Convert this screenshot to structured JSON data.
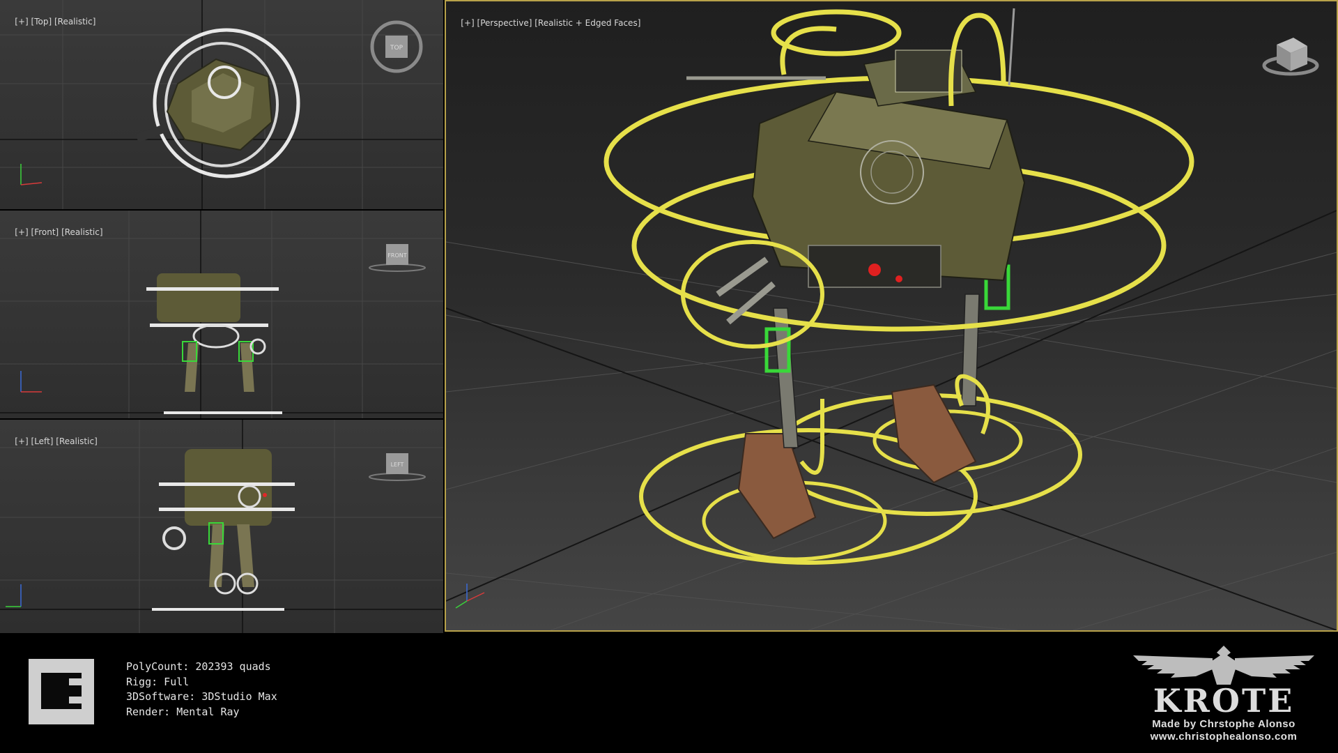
{
  "viewports": {
    "top": {
      "label_plus": "[+]",
      "label_view": "[Top]",
      "label_mode": "[Realistic]",
      "cube_label": "TOP"
    },
    "front": {
      "label_plus": "[+]",
      "label_view": "[Front]",
      "label_mode": "[Realistic]",
      "cube_label": "FRONT"
    },
    "left": {
      "label_plus": "[+]",
      "label_view": "[Left]",
      "label_mode": "[Realistic]",
      "cube_label": "LEFT"
    },
    "perspective": {
      "label_plus": "[+]",
      "label_view": "[Perspective]",
      "label_mode": "[Realistic + Edged Faces]"
    }
  },
  "stats": {
    "polycount": "PolyCount: 202393 quads",
    "rig": "Rigg: Full",
    "software": "3DSoftware: 3DStudio Max",
    "render": "Render: Mental Ray"
  },
  "brand": {
    "title": "KROTE",
    "credit": "Made by Chrstophe Alonso",
    "website": "www.christophealonso.com"
  },
  "colors": {
    "selection_yellow": "#e6e04a",
    "control_white": "#e8e8e8",
    "joint_green": "#39d839",
    "model_olive": "#6b6a3e",
    "viewport_border": "#b8a24a"
  },
  "icons": {
    "nav_cube": "view-cube-icon",
    "axis": "axis-tripod-icon",
    "logo": "author-logo-icon",
    "eagle": "eagle-emblem-icon"
  }
}
